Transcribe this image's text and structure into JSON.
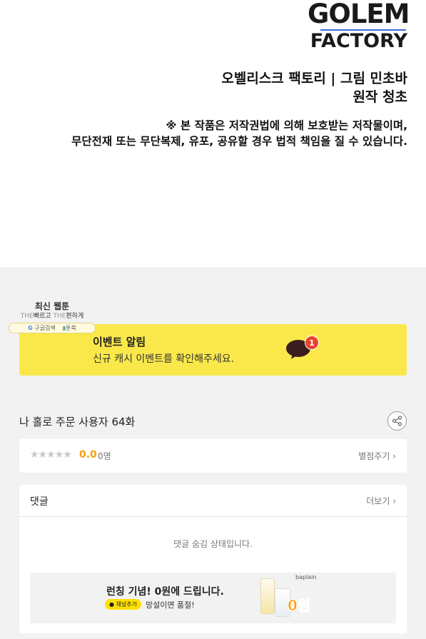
{
  "logo": {
    "line1": "GOLEM",
    "line2": "FACTORY"
  },
  "credit": {
    "line1": "오벨리스크 팩토리  |  그림 민초바",
    "line2": "원작 청초"
  },
  "notice": {
    "line1": "※ 본 작품은 저작권법에 의해 보호받는 저작물이며,",
    "line2": "무단전재 또는 무단복제, 유포, 공유할 경우 법적 책임을 질 수 있습니다."
  },
  "widget": {
    "title": "최신 웹툰",
    "the1": "THE",
    "text1": "빠르고",
    "the2": "THE",
    "text2": "편하게",
    "btn_google": "G",
    "btn_google_label": "구글검색",
    "btn_toon": "툰북"
  },
  "event": {
    "title": "이벤트 알림",
    "subtitle": "신규 캐시 이벤트를 확인해주세요.",
    "badge": "1",
    "accent": "#fae84b"
  },
  "episode": {
    "title": "나 홀로 주문 사용자 64화"
  },
  "rating": {
    "stars": "★★★★★",
    "score": "0.0",
    "count": "0명",
    "rate_button": "별점주기 ›"
  },
  "comments": {
    "header": "댓글",
    "more": "더보기 ›",
    "hidden_message": "댓글 숨김 상태입니다.",
    "ad": {
      "title": "런칭 기념! 0원에 드립니다.",
      "pill": "채널추가",
      "subtitle": "망설이면 품절!",
      "brand": "baplain",
      "price": "0원"
    }
  },
  "icons": {
    "share": "share-icon",
    "chat_bubble": "chat-bubble-icon"
  }
}
